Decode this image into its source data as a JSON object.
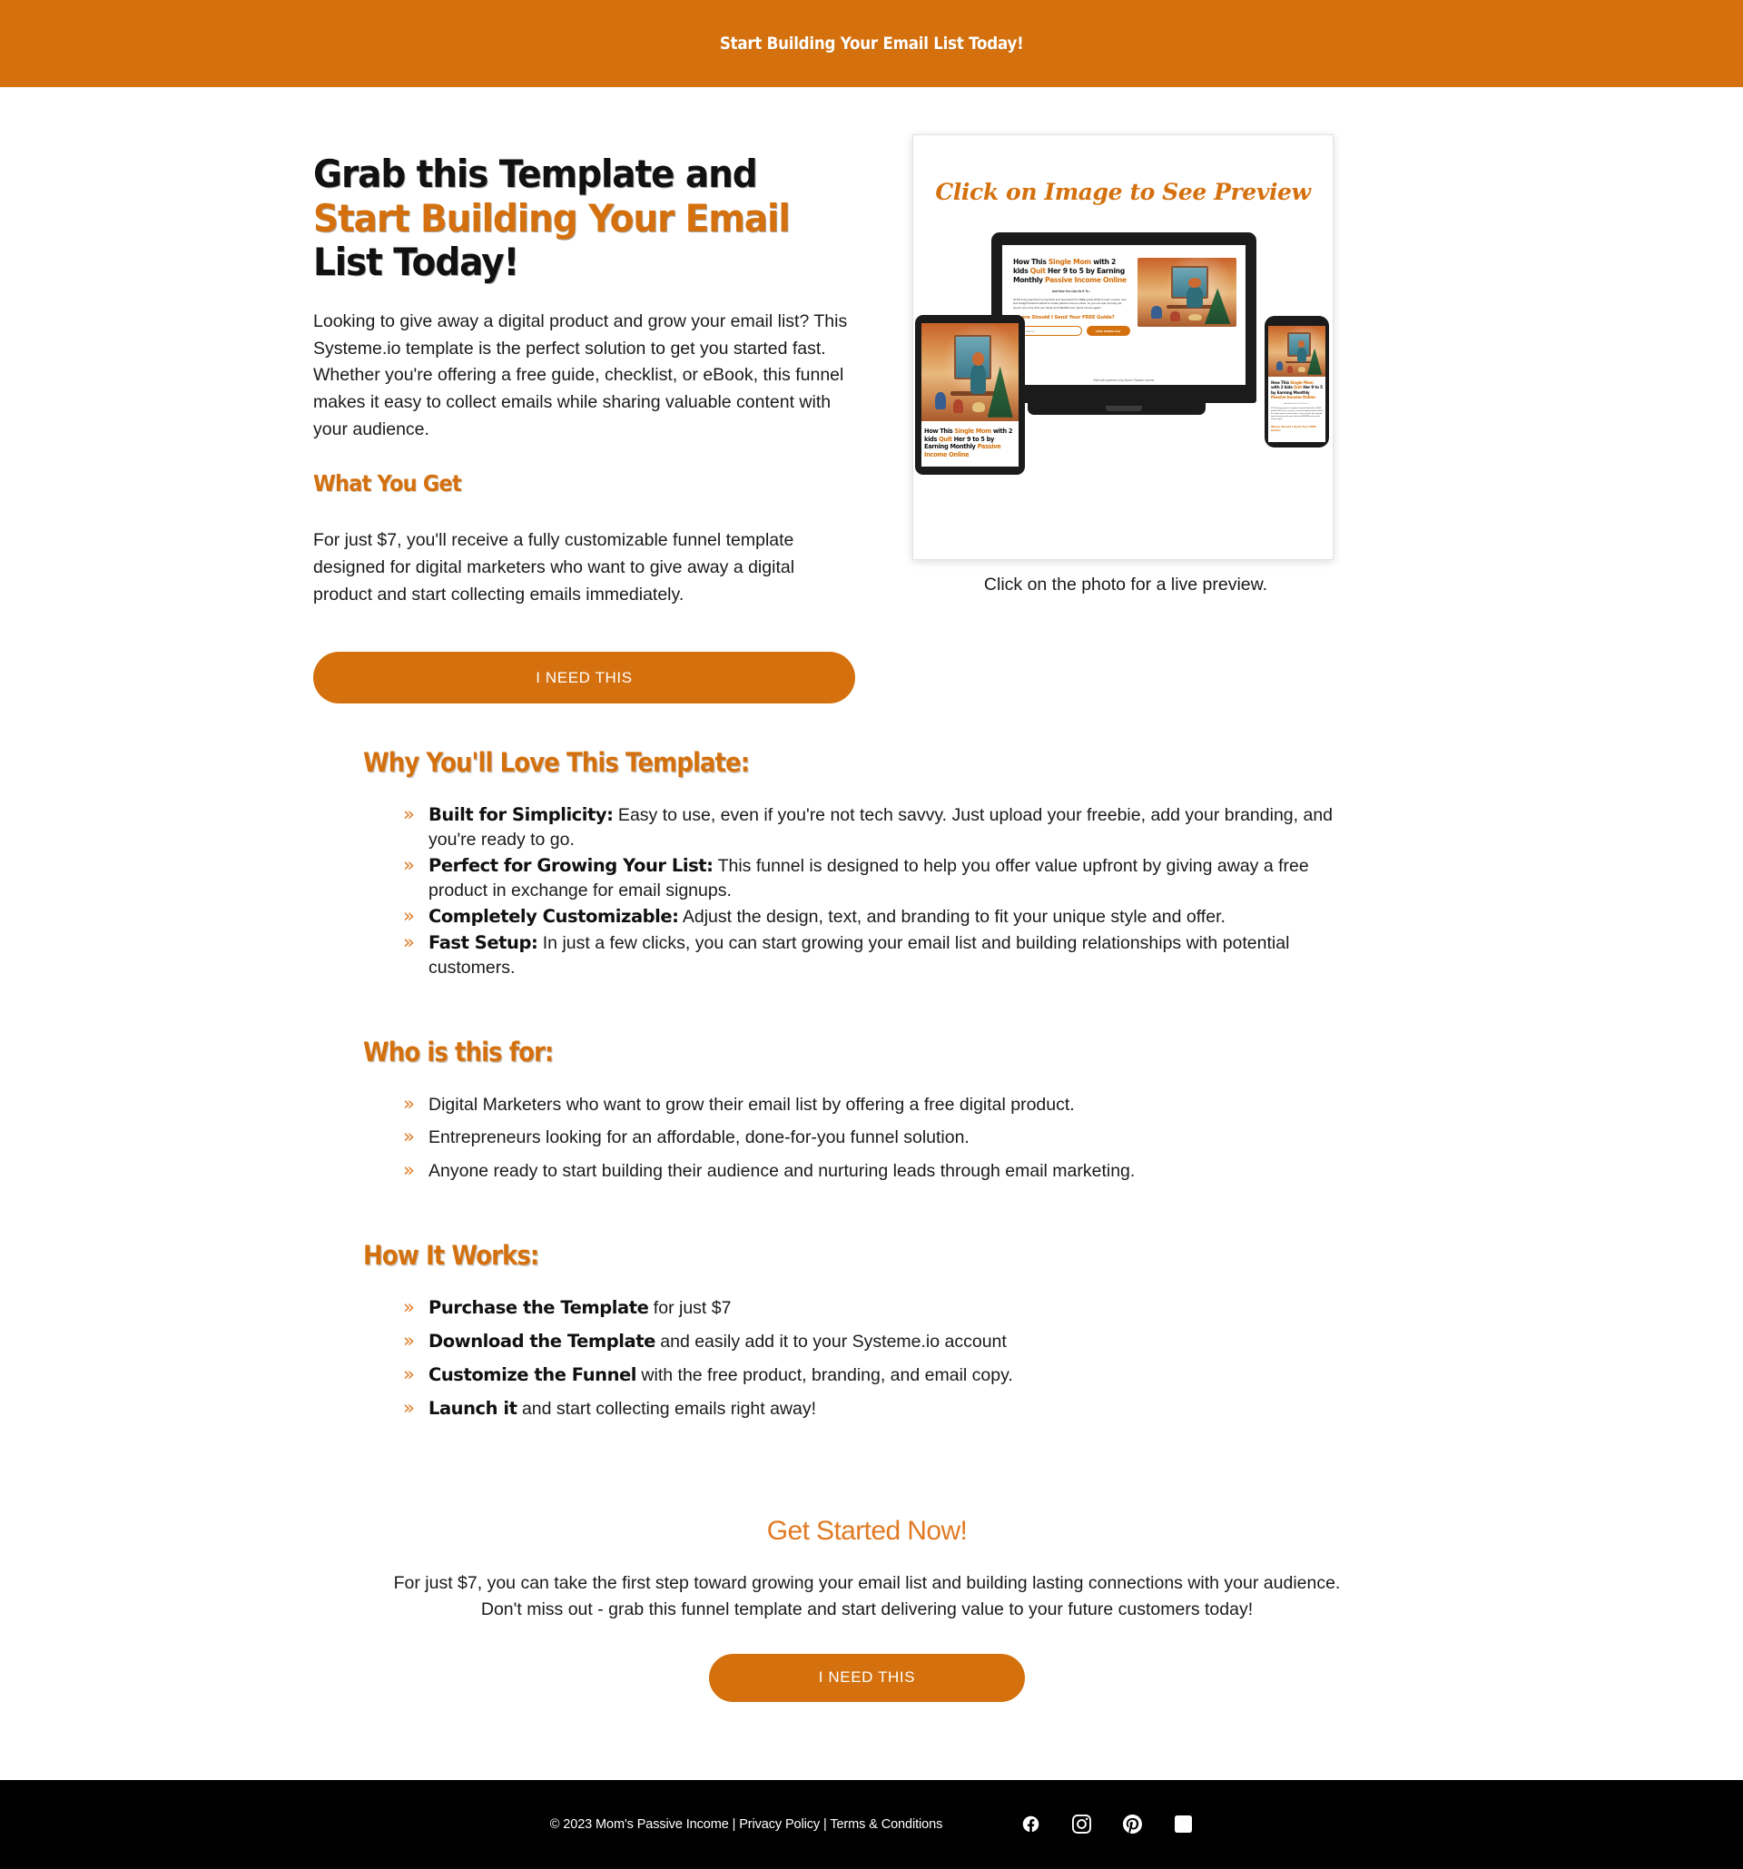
{
  "announcement": {
    "text": "Start Building Your Email List Today!"
  },
  "hero": {
    "title_part1": "Grab this Template and ",
    "title_highlight": "Start Building Your Email",
    "title_part2": " List Today!",
    "intro": "Looking to give away a digital product and grow your email list? This Systeme.io template is the perfect solution to get you started fast. Whether you're offering a free guide, checklist, or eBook, this funnel makes it easy to collect emails while sharing valuable content with your audience.",
    "what_you_get_label": "What You Get",
    "what_you_get_text": "For just $7, you'll receive a fully customizable funnel template designed for digital marketers who want to give away a digital product and start collecting emails immediately.",
    "cta_label": "I NEED THIS"
  },
  "mockup": {
    "overlay_title": "Click on Image to See Preview",
    "caption": "Click on the photo for a live preview.",
    "page": {
      "headline_1": "How This ",
      "headline_2": "Single Mom",
      "headline_3": " with 2 kids ",
      "headline_4": "Quit",
      "headline_5": " Her 9 to 5 by Earning Monthly ",
      "headline_6": "Passive Income Online",
      "subhead": "And How You Can Do It To...",
      "body": "STOP living paycheck to paycheck and download this FREE guide NOW to learn a quick, new and straight forward method to create passive income online, so you can quit your day job, spend more time with your family and NEVER worry about income again!",
      "form_question": "Where Should I Send Your FREE Guide?",
      "input_placeholder": "Email address",
      "submit_label": "FREE DOWNLOAD",
      "footer_note": "Built with systeme.io by Mom's Passive Income"
    }
  },
  "love_section": {
    "heading": "Why You'll Love This Template:",
    "items": [
      {
        "bold": "Built for Simplicity:",
        "rest": " Easy to use, even if you're not tech savvy. Just upload your freebie, add your branding, and you're ready to go."
      },
      {
        "bold": "Perfect for Growing Your List:",
        "rest": " This funnel is designed to help you offer value upfront by giving away a free product in exchange for email signups."
      },
      {
        "bold": "Completely Customizable:",
        "rest": " Adjust the design, text, and branding to fit your unique style and offer."
      },
      {
        "bold": "Fast Setup:",
        "rest": " In just a few clicks, you can start growing your email list and building relationships with potential customers."
      }
    ]
  },
  "who_section": {
    "heading": "Who is this for:",
    "items": [
      {
        "bold": "",
        "rest": "Digital Marketers who want to grow their email list by offering a free digital product."
      },
      {
        "bold": "",
        "rest": "Entrepreneurs looking for an affordable, done-for-you funnel solution."
      },
      {
        "bold": "",
        "rest": "Anyone ready to start building their audience and nurturing leads through email marketing."
      }
    ]
  },
  "how_section": {
    "heading": "How It Works:",
    "items": [
      {
        "bold": "Purchase the Template",
        "rest": " for just $7"
      },
      {
        "bold": "Download the Template",
        "rest": " and easily add it to your Systeme.io account"
      },
      {
        "bold": "Customize the Funnel",
        "rest": " with the free product, branding, and email copy."
      },
      {
        "bold": "Launch it",
        "rest": " and start collecting emails right away!"
      }
    ]
  },
  "final": {
    "heading": "Get Started Now!",
    "copy": "For just $7, you can take the first step toward growing your email list and building lasting connections with your audience. Don't miss out - grab this funnel template and start delivering value to your future customers today!",
    "cta_label": "I NEED THIS"
  },
  "footer": {
    "copyright": "© 2023 Mom's Passive Income",
    "sep1": " | ",
    "privacy": "Privacy Policy",
    "sep2": " | ",
    "terms": "Terms & Conditions",
    "social": [
      "facebook-icon",
      "instagram-icon",
      "pinterest-icon",
      "tiktok-icon"
    ]
  },
  "colors": {
    "accent": "#d4710e",
    "accent_light": "#e07b24",
    "footer_bg": "#000000",
    "text": "#1a1a1a"
  }
}
